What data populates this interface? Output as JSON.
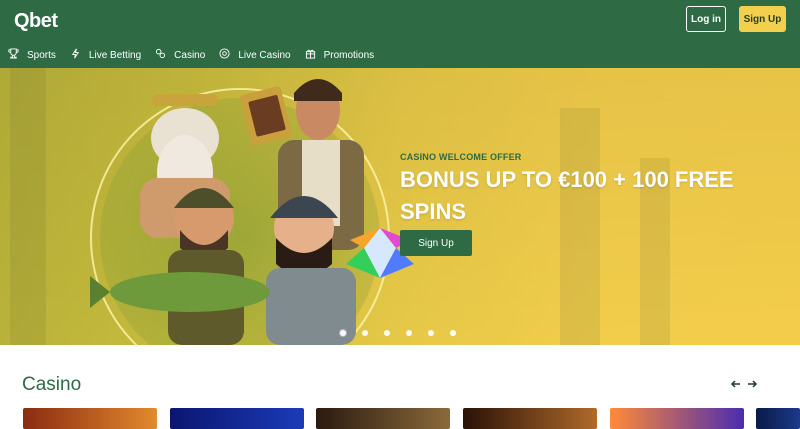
{
  "header": {
    "logo": "Qbet",
    "login_label": "Log in",
    "signup_label": "Sign Up",
    "accent_color": "#2e6b44",
    "signup_color": "#f3cf4e"
  },
  "nav": [
    {
      "label": "Sports",
      "icon": "trophy-icon"
    },
    {
      "label": "Live Betting",
      "icon": "bolt-icon"
    },
    {
      "label": "Casino",
      "icon": "casino-icon"
    },
    {
      "label": "Live Casino",
      "icon": "live-casino-icon"
    },
    {
      "label": "Promotions",
      "icon": "gift-icon"
    }
  ],
  "hero": {
    "kicker": "CASINO WELCOME OFFER",
    "title": "BONUS UP TO €100 + 100 FREE SPINS",
    "cta_label": "Sign Up",
    "carousel_count": 6,
    "active_slide": 1
  },
  "casino": {
    "title": "Casino"
  }
}
